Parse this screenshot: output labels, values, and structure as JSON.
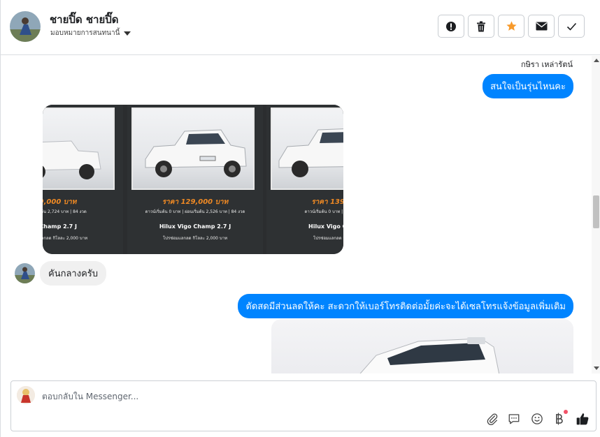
{
  "header": {
    "contact_name": "ชายปิ๊ด ชายปิ๊ด",
    "assign_label": "มอบหมายการสนทนานี้",
    "actions": [
      {
        "name": "report-button",
        "icon": "alert-icon"
      },
      {
        "name": "delete-button",
        "icon": "trash-icon"
      },
      {
        "name": "star-button",
        "icon": "star-icon"
      },
      {
        "name": "mark-unread-button",
        "icon": "envelope-icon"
      },
      {
        "name": "mark-done-button",
        "icon": "check-icon"
      }
    ]
  },
  "conversation": {
    "sender_name": "กษิรา เหล่ารัตน์",
    "messages": [
      {
        "from": "page",
        "text": "สนใจเป็นรุ่นไหนคะ"
      },
      {
        "from": "page",
        "type": "image",
        "panels": [
          {
            "price": "39,000 บาท",
            "down": "ดาวน์เริ่มต้น 2,724 บาท | 84 งวด",
            "model": "o Champ 2.7 J",
            "trade": "โปรซ่อมแลกลด กิโลละ 2,000 บาท"
          },
          {
            "price": "ราคา 129,000 บาท",
            "down": "ดาวน์เริ่มต้น 0 บาท | ผ่อนเริ่มต้น 2,526 บาท | 84 งวด",
            "model": "Hilux Vigo Champ 2.7 J",
            "trade": "โปรซ่อมแลกลด กิโลละ 2,000 บาท"
          },
          {
            "price": "ราคา 139,00",
            "down": "ดาวน์เริ่มต้น 0 บาท | ผ่อนเริ่มต้น",
            "model": "Hilux Vigo Cham",
            "trade": "โปรซ่อมแลกลด กิโลละ"
          }
        ]
      },
      {
        "from": "customer",
        "text": "คันกลางครับ"
      },
      {
        "from": "page",
        "text": "ตัดสดมีส่วนลดให้คะ สะดวกให้เบอร์โทรติดต่อมั้ยค่ะจะได้เซลโทรแจ้งข้อมูลเพิ่มเติม"
      }
    ]
  },
  "reply": {
    "placeholder": "ตอบกลับใน Messenger...",
    "icons": [
      "attach-icon",
      "saved-replies-icon",
      "emoji-icon",
      "payment-icon",
      "like-icon"
    ],
    "accent": "#0084ff"
  }
}
